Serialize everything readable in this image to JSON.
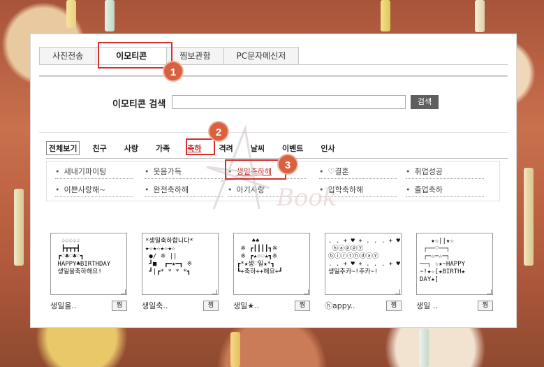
{
  "tabs": [
    {
      "label": "사진전송"
    },
    {
      "label": "이모티콘"
    },
    {
      "label": "찜보관함"
    },
    {
      "label": "PC문자메신저"
    }
  ],
  "search": {
    "label": "이모티콘 검색",
    "button": "검색",
    "value": ""
  },
  "categories": [
    "전체보기",
    "친구",
    "사랑",
    "가족",
    "축하",
    "격려",
    "날씨",
    "이벤트",
    "인사"
  ],
  "subcategories": [
    [
      "새내기파이팅",
      "웃음가득",
      "생일축하해",
      "♡결혼",
      "취업성공"
    ],
    [
      "이쁜사랑해~",
      "완전축하해",
      "아기사랑",
      "입학축하해",
      "졸업축하"
    ]
  ],
  "cards": [
    {
      "art": "  ♤♤♤♤♤\n  ┣┳┳┳┫\n ┏♡♣♡♣♡┓\n HAPPY♣BIRTHDAY\n 생일을축하해요!",
      "title": "생일을..",
      "button": "찜"
    },
    {
      "art": "*생일축하합니다*\n★☆★☆★☆★☆\n ●/ ※ ||\n ┛■  ┏━★━┓ ※\n ┛|┏* * * *┓",
      "title": "생일축..",
      "button": "찜"
    },
    {
      "art": "    ♠♠\n ※ ┏┃┃┃┃┓※\n ※ ┏★♧♤★┓※\n┏*★생♡일★*┓\n┗+축하++해요+┛",
      "title": "생일★..",
      "button": "찜"
    },
    {
      "art": ". . + ♥ + . . . + ♥ + .\n ⓗⓐⓟⓟⓨ\nⓑⓘⓡⓣⓗⓓⓐⓨ\n. . + ♥ + . . . + ♥ + .\n생일추카~!추카~!",
      "title": "ⓗappy..",
      "button": "찜"
    },
    {
      "art": "   ★☆||★☆\n ┌──♡──┐\n ┌─☆─☆─┐\n──┐ ☆★~HAPPY\n~!★☆[★BIRTH★\nDAY★]",
      "title": "생일 ..",
      "button": "찜"
    }
  ],
  "annotations": [
    "1",
    "2",
    "3"
  ],
  "watermark": "Book",
  "colors": {
    "accent": "#d32f2f",
    "marker": "#d9613f",
    "selected": "#c62828"
  }
}
